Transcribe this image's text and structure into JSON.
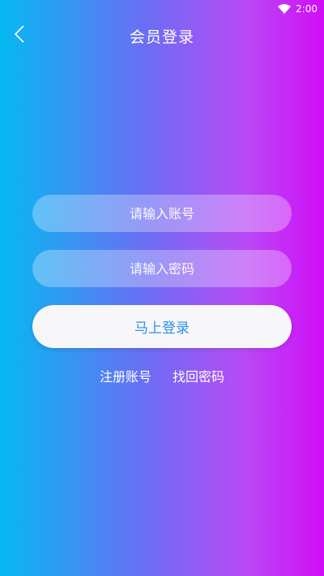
{
  "status_bar": {
    "time": "2:00",
    "icons": [
      "wifi-icon"
    ]
  },
  "header": {
    "title": "会员登录",
    "back_icon": "chevron-left-icon"
  },
  "form": {
    "account_placeholder": "请输入账号",
    "account_value": "",
    "password_placeholder": "请输入密码",
    "password_value": "",
    "login_label": "马上登录"
  },
  "links": {
    "register": "注册账号",
    "recover": "找回密码"
  },
  "colors": {
    "gradient_start": "#05b9f2",
    "gradient_end": "#d00ef7",
    "button_text": "#2e8fe8"
  }
}
